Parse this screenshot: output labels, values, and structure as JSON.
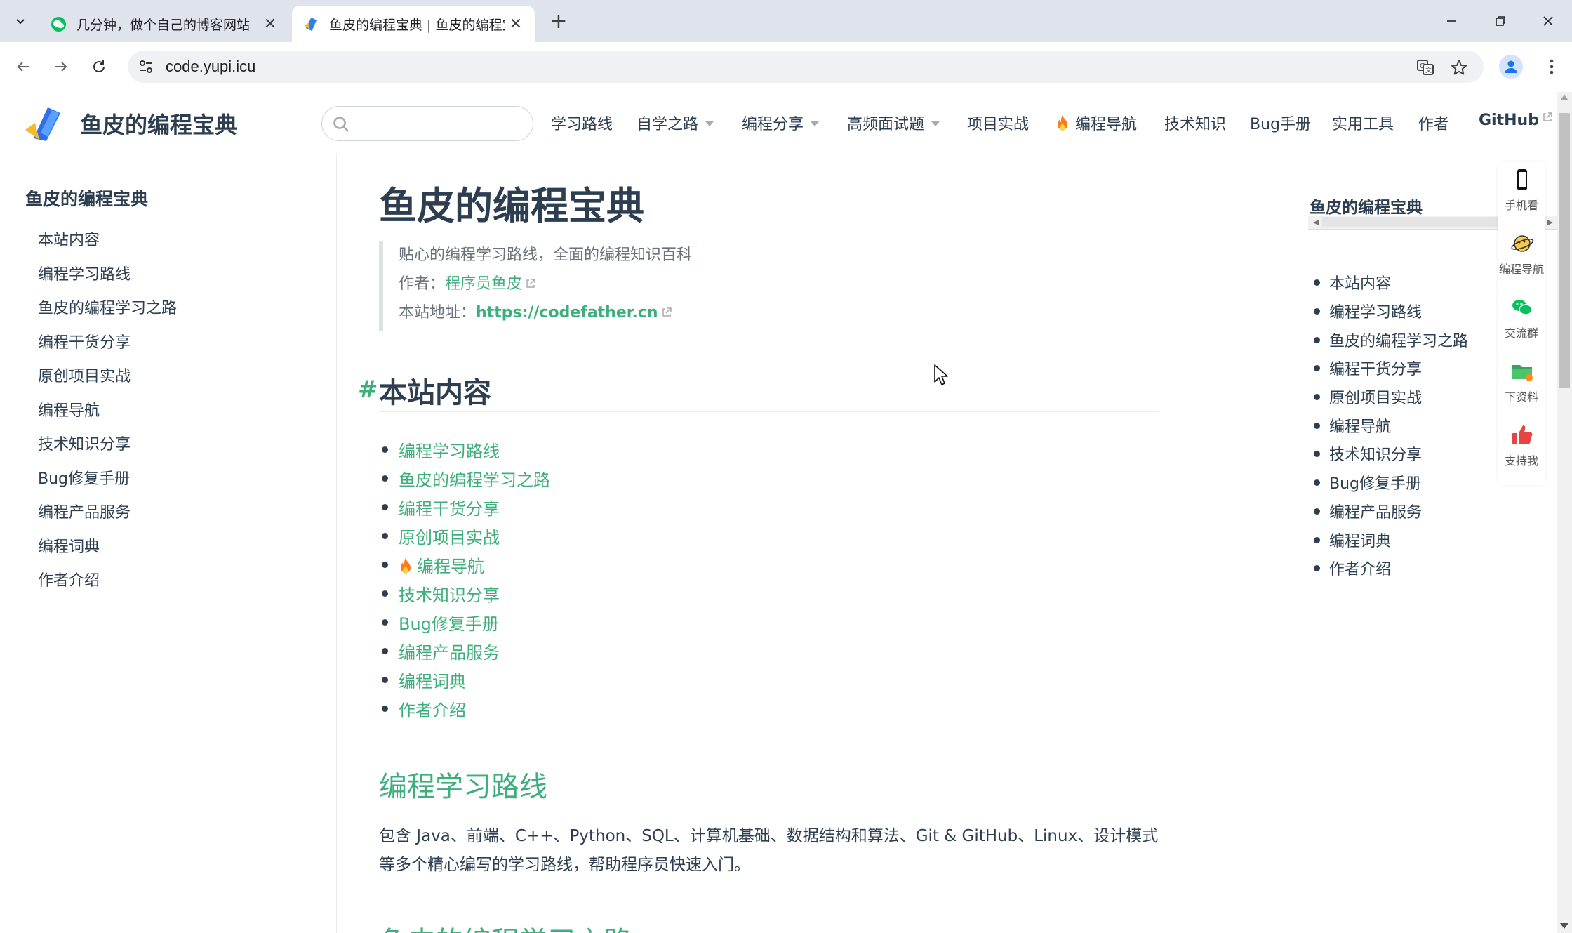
{
  "browser": {
    "tabs": [
      {
        "title": "几分钟，做个自己的博客网站",
        "active": false,
        "favicon": "wechat-icon"
      },
      {
        "title": "鱼皮的编程宝典 | 鱼皮的编程宝",
        "active": true,
        "favicon": "site-logo-icon"
      }
    ],
    "new_tab": "+",
    "close": "✕",
    "url": "code.yupi.icu"
  },
  "site": {
    "title": "鱼皮的编程宝典",
    "search_placeholder": "",
    "nav": [
      {
        "label": "学习路线"
      },
      {
        "label": "自学之路"
      },
      {
        "label": "编程分享"
      },
      {
        "label": "高频面试题"
      },
      {
        "label": "项目实战"
      },
      {
        "label": "编程导航"
      },
      {
        "label": "技术知识"
      },
      {
        "label": "Bug手册"
      },
      {
        "label": "实用工具"
      },
      {
        "label": "作者"
      },
      {
        "label": "GitHub"
      }
    ]
  },
  "sidebar": {
    "heading": "鱼皮的编程宝典",
    "items": [
      "本站内容",
      "编程学习路线",
      "鱼皮的编程学习之路",
      "编程干货分享",
      "原创项目实战",
      "编程导航",
      "技术知识分享",
      "Bug修复手册",
      "编程产品服务",
      "编程词典",
      "作者介绍"
    ]
  },
  "content": {
    "title": "鱼皮的编程宝典",
    "quote": {
      "line1": "贴心的编程学习路线，全面的编程知识百科",
      "author_label": "作者：",
      "author_link": "程序员鱼皮",
      "site_label": "本站地址：",
      "site_link": "https://codefather.cn"
    },
    "section_hash": "#",
    "section_title": "本站内容",
    "list": [
      "编程学习路线",
      "鱼皮的编程学习之路",
      "编程干货分享",
      "原创项目实战",
      "编程导航",
      "技术知识分享",
      "Bug修复手册",
      "编程产品服务",
      "编程词典",
      "作者介绍"
    ],
    "h2_learning": "编程学习路线",
    "learning_desc": "包含 Java、前端、C++、Python、SQL、计算机基础、数据结构和算法、Git & GitHub、Linux、设计模式等多个精心编写的学习路线，帮助程序员快速入门。",
    "h2_next": "鱼皮的编程学习之路"
  },
  "toc": {
    "heading": "鱼皮的编程宝典",
    "items": [
      "本站内容",
      "编程学习路线",
      "鱼皮的编程学习之路",
      "编程干货分享",
      "原创项目实战",
      "编程导航",
      "技术知识分享",
      "Bug修复手册",
      "编程产品服务",
      "编程词典",
      "作者介绍"
    ]
  },
  "float_bar": [
    {
      "label": "手机看",
      "icon": "phone-icon"
    },
    {
      "label": "编程导航",
      "icon": "planet-icon"
    },
    {
      "label": "交流群",
      "icon": "wechat-icon"
    },
    {
      "label": "下资料",
      "icon": "folder-icon"
    },
    {
      "label": "支持我",
      "icon": "thumbs-up-icon"
    }
  ],
  "colors": {
    "accent": "#3eaf7c",
    "text": "#2c3e50",
    "tabbar": "#dfe3eb"
  }
}
